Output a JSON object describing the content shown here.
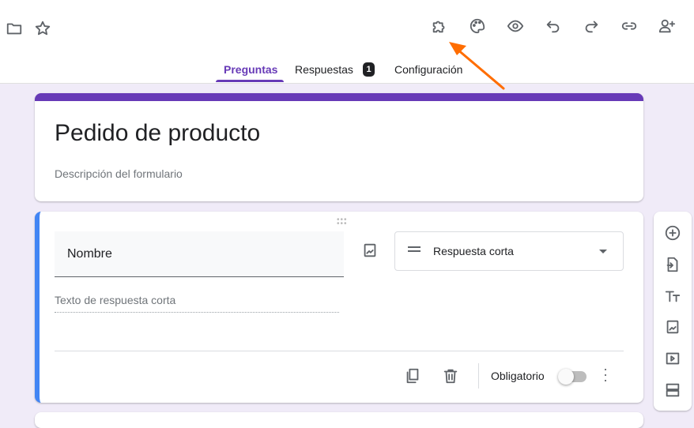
{
  "header": {
    "tabs": [
      {
        "label": "Preguntas",
        "active": true
      },
      {
        "label": "Respuestas",
        "badge": "1"
      },
      {
        "label": "Configuración"
      }
    ]
  },
  "form": {
    "title": "Pedido de producto",
    "description": "Descripción del formulario"
  },
  "question": {
    "title": "Nombre",
    "type": "Respuesta corta",
    "answer_placeholder": "Texto de respuesta corta",
    "required_label": "Obligatorio",
    "required": false
  },
  "colors": {
    "accent": "#673ab7",
    "active_card": "#4285f4",
    "arrow": "#ff6d00"
  }
}
